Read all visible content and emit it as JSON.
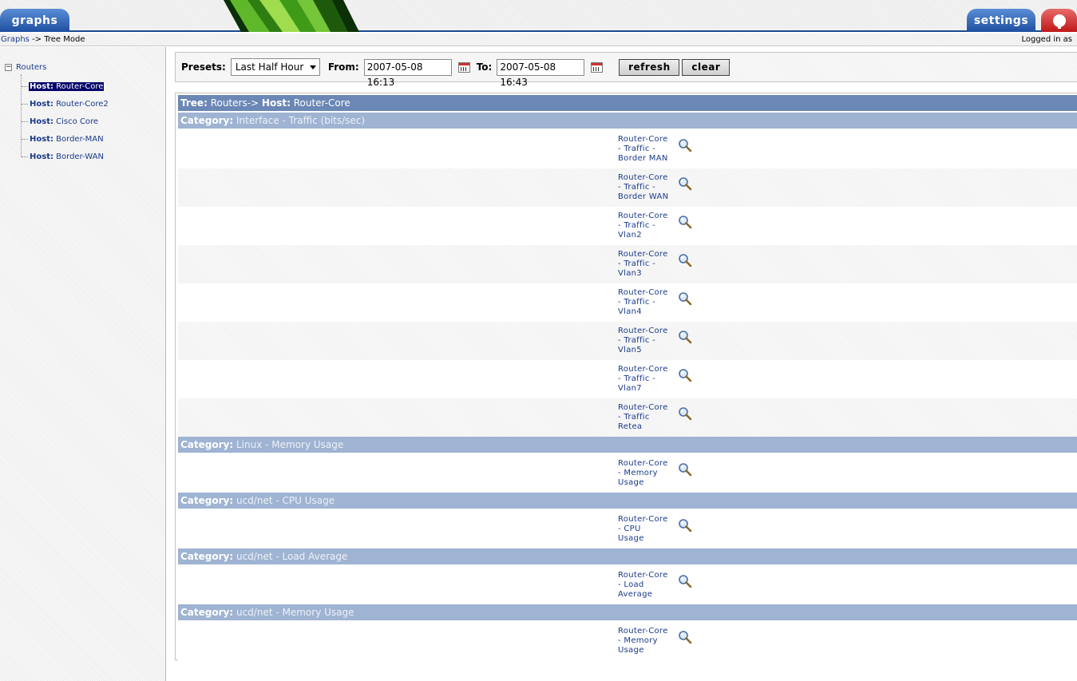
{
  "header": {
    "tab_graphs": "graphs",
    "tab_settings": "settings",
    "help_icon": "help-balloon-icon"
  },
  "breadcrumb": {
    "link": "Graphs",
    "rest": " -> Tree Mode",
    "logged_in": "Logged in as"
  },
  "sidebar": {
    "root_label": "Routers",
    "expander": "−",
    "hosts": [
      {
        "prefix": "Host:",
        "name": "Router-Core",
        "selected": true
      },
      {
        "prefix": "Host:",
        "name": "Router-Core2",
        "selected": false
      },
      {
        "prefix": "Host:",
        "name": "Cisco Core",
        "selected": false
      },
      {
        "prefix": "Host:",
        "name": "Border-MAN",
        "selected": false
      },
      {
        "prefix": "Host:",
        "name": "Border-WAN",
        "selected": false
      }
    ]
  },
  "presets": {
    "presets_label": "Presets:",
    "preset_value": "Last Half Hour",
    "from_label": "From:",
    "from_value": "2007-05-08 16:13",
    "to_label": "To:",
    "to_value": "2007-05-08 16:43",
    "refresh_label": "refresh",
    "clear_label": "clear"
  },
  "content": {
    "tree_header": {
      "tree_label": "Tree:",
      "tree_value": " Routers-> ",
      "host_label": "Host:",
      "host_value": " Router-Core"
    },
    "categories": [
      {
        "label": "Category:",
        "name": " Interface - Traffic (bits/sec)",
        "graphs": [
          [
            "Router-Core",
            "- Traffic -",
            "Border MAN"
          ],
          [
            "Router-Core",
            "- Traffic -",
            "Border WAN"
          ],
          [
            "Router-Core",
            "- Traffic -",
            "Vlan2"
          ],
          [
            "Router-Core",
            "- Traffic -",
            "Vlan3"
          ],
          [
            "Router-Core",
            "- Traffic -",
            "Vlan4"
          ],
          [
            "Router-Core",
            "- Traffic -",
            "Vlan5"
          ],
          [
            "Router-Core",
            "- Traffic -",
            "Vlan7"
          ],
          [
            "Router-Core",
            "- Traffic",
            "Retea"
          ]
        ]
      },
      {
        "label": "Category:",
        "name": " Linux - Memory Usage",
        "graphs": [
          [
            "Router-Core",
            "- Memory",
            "Usage"
          ]
        ]
      },
      {
        "label": "Category:",
        "name": " ucd/net - CPU Usage",
        "graphs": [
          [
            "Router-Core",
            "- CPU",
            "Usage"
          ]
        ]
      },
      {
        "label": "Category:",
        "name": " ucd/net - Load Average",
        "graphs": [
          [
            "Router-Core",
            "- Load",
            "Average"
          ]
        ]
      },
      {
        "label": "Category:",
        "name": " ucd/net - Memory Usage",
        "graphs": [
          [
            "Router-Core",
            "- Memory",
            "Usage"
          ]
        ]
      }
    ]
  }
}
